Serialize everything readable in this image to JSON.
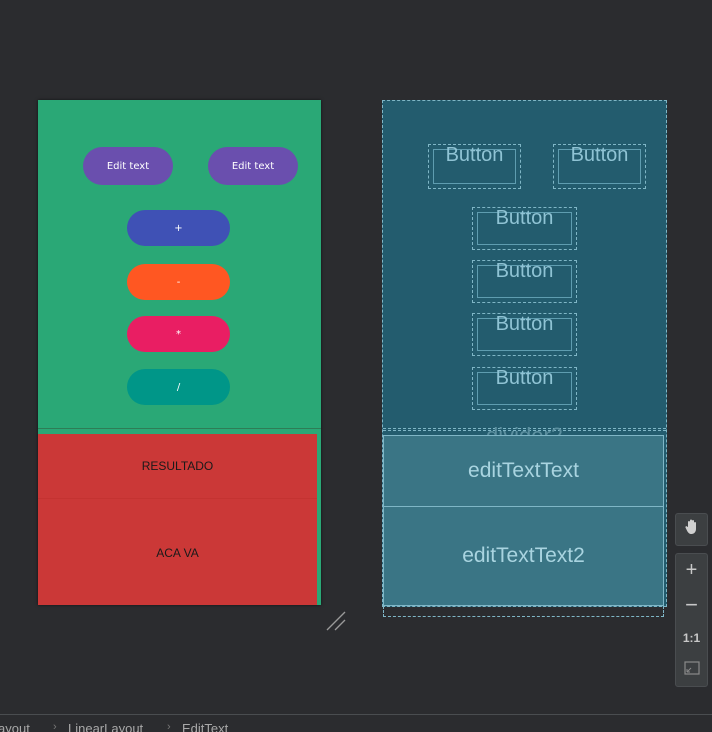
{
  "design": {
    "edit_text_1": "Edit text",
    "edit_text_2": "Edit text",
    "op_plus": "+",
    "op_minus": "-",
    "op_mult": "*",
    "op_div": "/",
    "result_label": "RESULTADO",
    "result_value": "ACA VA"
  },
  "blueprint": {
    "button_1": "Button",
    "button_2": "Button",
    "button_3": "Button",
    "button_4": "Button",
    "button_5": "Button",
    "button_6": "Button",
    "divider": "divider2",
    "edit_1": "editTextText",
    "edit_2": "editTextText2"
  },
  "toolbar": {
    "zoom_in": "+",
    "zoom_out": "−",
    "one_to_one": "1:1"
  },
  "breadcrumb": {
    "item_1": "ayout",
    "item_2": "LinearLayout",
    "item_3": "EditText"
  },
  "colors": {
    "background": "#2b2c2f",
    "design_green": "#2aa876",
    "edit_purple": "#6a4fae",
    "plus_blue": "#3f51b5",
    "minus_orange": "#ff5722",
    "mult_pink": "#e91e63",
    "div_teal": "#009688",
    "result_red": "#cb3837",
    "blueprint_bg": "#235c6e"
  }
}
